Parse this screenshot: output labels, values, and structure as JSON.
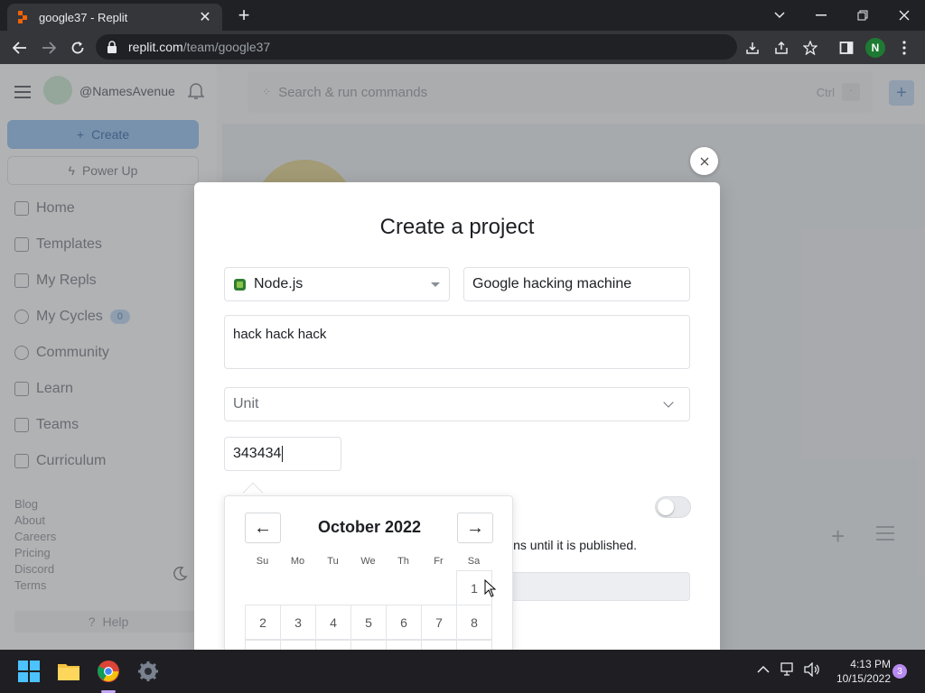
{
  "browser": {
    "tab_title": "google37 - Replit",
    "tab_close": "✕",
    "new_tab": "+",
    "url_domain": "replit.com",
    "url_path": "/team/google37",
    "profile_initial": "N"
  },
  "sidebar": {
    "username": "@NamesAvenue",
    "create_label": "Create",
    "powerup_label": "Power Up",
    "nav": [
      {
        "label": "Home",
        "icon": "home-icon"
      },
      {
        "label": "Templates",
        "icon": "templates-icon"
      },
      {
        "label": "My Repls",
        "icon": "folder-icon"
      },
      {
        "label": "My Cycles",
        "icon": "cycles-icon",
        "badge": "0"
      },
      {
        "label": "Community",
        "icon": "globe-icon"
      },
      {
        "label": "Learn",
        "icon": "learn-icon"
      },
      {
        "label": "Teams",
        "icon": "teams-icon"
      },
      {
        "label": "Curriculum",
        "icon": "book-icon"
      }
    ],
    "footer_links": [
      "Blog",
      "About",
      "Careers",
      "Pricing",
      "Discord",
      "Terms"
    ],
    "help_label": "Help"
  },
  "topbar": {
    "search_placeholder": "Search & run commands",
    "shortcut": "Ctrl",
    "shortcut_key": "."
  },
  "modal": {
    "title": "Create a project",
    "language": "Node.js",
    "project_title": "Google hacking machine",
    "description": "hack hack hack",
    "unit_placeholder": "Unit",
    "date_value": "343434",
    "publish_note": "ins until it is published."
  },
  "calendar": {
    "month_label": "October 2022",
    "prev": "←",
    "next": "→",
    "weekdays": [
      "Su",
      "Mo",
      "Tu",
      "We",
      "Th",
      "Fr",
      "Sa"
    ],
    "days_row1": [
      "1"
    ],
    "days_row2": [
      "2",
      "3",
      "4",
      "5",
      "6",
      "7",
      "8"
    ]
  },
  "taskbar": {
    "time": "4:13 PM",
    "date": "10/15/2022",
    "notifications": "3"
  },
  "colors": {
    "accent": "#a4c8f0",
    "replit_orange": "#f26207",
    "profile_green": "#1e7a32"
  }
}
